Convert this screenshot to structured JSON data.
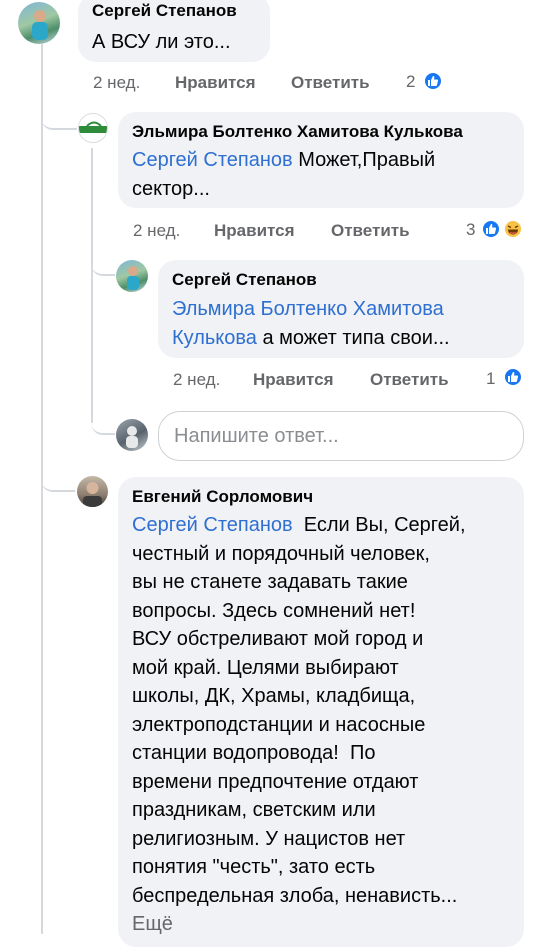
{
  "comments": [
    {
      "author": "Сергей Степанов",
      "text": "А ВСУ ли это...",
      "time": "2 нед.",
      "like": "Нравится",
      "reply": "Ответить",
      "reactions": "2"
    },
    {
      "author": "Эльмира Болтенко Хамитова Кулькова",
      "mention": "Сергей Степанов",
      "text_line1": " Может,Правый",
      "text_line2": "сектор...",
      "time": "2 нед.",
      "like": "Нравится",
      "reply": "Ответить",
      "reactions": "3"
    },
    {
      "author": "Сергей Степанов",
      "mention_line1": "Эльмира Болтенко Хамитова",
      "mention_line2": "Кулькова",
      "text": " а может типа свои...",
      "time": "2 нед.",
      "like": "Нравится",
      "reply": "Ответить",
      "reactions": "1"
    },
    {
      "author": "Евгений Сорломович",
      "mention": "Сергей Степанов",
      "lines": [
        "  Если Вы, Сергей,",
        "честный и порядочный человек,",
        "вы не станете задавать такие",
        "вопросы. Здесь сомнений нет!",
        "ВСУ обстреливают мой город и",
        "мой край. Целями выбирают",
        "школы, ДК, Храмы, кладбища,",
        "электроподстанции и насосные",
        "станции водопровода!  По",
        "времени предпочтение отдают",
        "праздникам, светским или",
        "религиозным. У нацистов нет",
        "понятия \"честь\", зато есть",
        "беспредельная злоба, ненависть..."
      ],
      "see_more": "Ещё"
    }
  ],
  "reply_input": {
    "placeholder": "Напишите ответ..."
  },
  "colors": {
    "mention": "#2f6fd0",
    "like": "#1877f2",
    "haha": "#f7c245",
    "bubble": "#f0f2f5"
  },
  "icons": [
    "like-icon",
    "haha-icon"
  ]
}
